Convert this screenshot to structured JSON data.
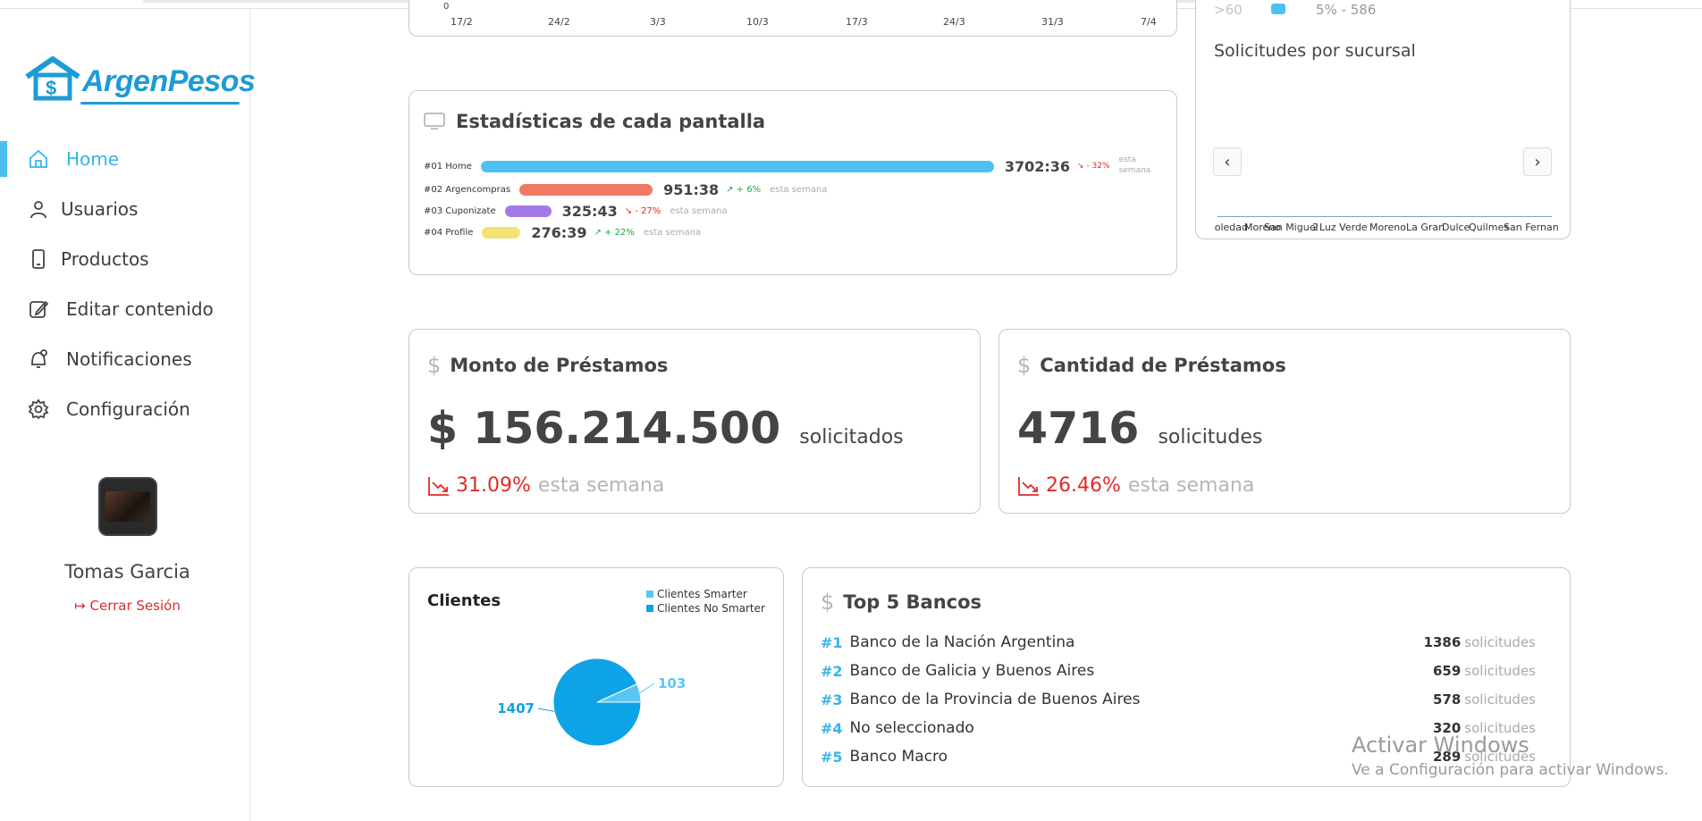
{
  "brand": {
    "name": "ArgenPesos",
    "accent": "#38b4ea"
  },
  "nav": {
    "items": [
      {
        "label": "Home",
        "icon": "home-icon",
        "active": true
      },
      {
        "label": "Usuarios",
        "icon": "user-icon"
      },
      {
        "label": "Productos",
        "icon": "phone-icon"
      },
      {
        "label": "Editar contenido",
        "icon": "edit-icon"
      },
      {
        "label": "Notificaciones",
        "icon": "bell-icon"
      },
      {
        "label": "Configuración",
        "icon": "gear-icon"
      }
    ]
  },
  "user": {
    "name": "Tomas Garcia",
    "logout_label": "Cerrar Sesión"
  },
  "top_chart": {
    "x_ticks": [
      "17/2",
      "24/2",
      "3/3",
      "10/3",
      "17/3",
      "24/3",
      "31/3",
      "7/4"
    ],
    "y_tick": "0"
  },
  "screen_stats": {
    "title": "Estadísticas de cada pantalla",
    "rows": [
      {
        "label": "#01 Home",
        "time": "3702:36",
        "trend": "- 32%",
        "direction": "down",
        "suffix": "esta semana",
        "color": "#4dc1f4",
        "share": 1.0
      },
      {
        "label": "#02 Argencompras",
        "time": "951:38",
        "trend": "+ 6%",
        "direction": "up",
        "suffix": "esta semana",
        "color": "#f07a63",
        "share": 0.26
      },
      {
        "label": "#03 Cuponizate",
        "time": "325:43",
        "trend": "- 27%",
        "direction": "down",
        "suffix": "esta semana",
        "color": "#a679ea",
        "share": 0.09
      },
      {
        "label": "#04 Profile",
        "time": "276:39",
        "trend": "+ 22%",
        "direction": "up",
        "suffix": "esta semana",
        "color": "#f4e373",
        "share": 0.075
      }
    ]
  },
  "branch_card": {
    "legend_prefix": ">60",
    "legend_text": "5% - 586",
    "title": "Solicitudes por sucursal",
    "branches": [
      "Soledad",
      "Moreno",
      "San Miguel",
      "2",
      "Luz Verde",
      "Moreno",
      "La Gran",
      "Dulce",
      "Quilmes",
      "San Fernan"
    ]
  },
  "loan_amount": {
    "title": "Monto de Préstamos",
    "value": "$ 156.214.500",
    "unit": "solicitados",
    "change": "31.09%",
    "period": "esta semana"
  },
  "loan_count": {
    "title": "Cantidad de Préstamos",
    "value": "4716",
    "unit": "solicitudes",
    "change": "26.46%",
    "period": "esta semana"
  },
  "clients": {
    "title": "Clientes",
    "chart_data": {
      "type": "pie",
      "categories": [
        "Clientes Smarter",
        "Clientes No Smarter"
      ],
      "values": [
        103,
        1407
      ],
      "colors": [
        "#5bc6f5",
        "#0ea2e6"
      ]
    }
  },
  "top_banks": {
    "title": "Top 5 Bancos",
    "unit": "solicitudes",
    "rows": [
      {
        "rank": "#1",
        "name": "Banco de la Nación Argentina",
        "count": "1386"
      },
      {
        "rank": "#2",
        "name": "Banco de Galicia y Buenos Aires",
        "count": "659"
      },
      {
        "rank": "#3",
        "name": "Banco de la Provincia de Buenos Aires",
        "count": "578"
      },
      {
        "rank": "#4",
        "name": "No seleccionado",
        "count": "320"
      },
      {
        "rank": "#5",
        "name": "Banco Macro",
        "count": "289"
      }
    ]
  },
  "watermark": {
    "line1": "Activar Windows",
    "line2": "Ve a Configuración para activar Windows."
  }
}
